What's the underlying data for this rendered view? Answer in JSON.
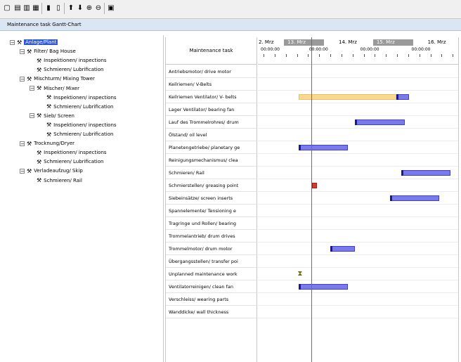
{
  "toolbar": {
    "buttons": [
      {
        "name": "new-document-icon",
        "glyph": "▢"
      },
      {
        "name": "print-icon",
        "glyph": "▤"
      },
      {
        "name": "print-preview-icon",
        "glyph": "▥"
      },
      {
        "name": "export-icon",
        "glyph": "▦"
      },
      {
        "name": "columns-icon",
        "glyph": "▮"
      },
      {
        "name": "page-setup-icon",
        "glyph": "▯"
      },
      {
        "name": "move-up-icon",
        "glyph": "⬆"
      },
      {
        "name": "move-down-icon",
        "glyph": "⬇"
      },
      {
        "name": "zoom-in-icon",
        "glyph": "⊕"
      },
      {
        "name": "zoom-out-icon",
        "glyph": "⊖"
      },
      {
        "name": "clipboard-icon",
        "glyph": "▣"
      }
    ]
  },
  "window": {
    "title": "Maintenance task Gantt-Chart"
  },
  "tree": {
    "nodes": [
      {
        "label": "Anlage/Plant",
        "depth": 0,
        "toggle": "−",
        "selected": true
      },
      {
        "label": "Filter/ Bag House",
        "depth": 1,
        "toggle": "−"
      },
      {
        "label": "Inspektionen/ inspections",
        "depth": 2,
        "toggle": ""
      },
      {
        "label": "Schmieren/ Lubrification",
        "depth": 2,
        "toggle": ""
      },
      {
        "label": "Mischturm/ Mixing Tower",
        "depth": 1,
        "toggle": "−"
      },
      {
        "label": "Mischer/ Mixer",
        "depth": 2,
        "toggle": "−"
      },
      {
        "label": "Inspektionen/ inspections",
        "depth": 3,
        "toggle": ""
      },
      {
        "label": "Schmieren/ Lubrification",
        "depth": 3,
        "toggle": ""
      },
      {
        "label": "Sieb/ Screen",
        "depth": 2,
        "toggle": "−"
      },
      {
        "label": "Inspektionen/ inspections",
        "depth": 3,
        "toggle": ""
      },
      {
        "label": "Schmieren/ Lubrification",
        "depth": 3,
        "toggle": ""
      },
      {
        "label": "Trocknung/Dryer",
        "depth": 1,
        "toggle": "−"
      },
      {
        "label": "Inspektionen/ inspections",
        "depth": 2,
        "toggle": ""
      },
      {
        "label": "Schmieren/ Lubrification",
        "depth": 2,
        "toggle": ""
      },
      {
        "label": "Verladeaufzug/ Skip",
        "depth": 1,
        "toggle": "−"
      },
      {
        "label": "Schmieren/ Rail",
        "depth": 2,
        "toggle": ""
      }
    ]
  },
  "tasks": {
    "header": "Maintenance task",
    "rows": [
      "Antriebsmotor/ drive motor",
      "Keilriemen/ V-Belts",
      "Keilriemen Ventilator/ V- belts",
      "Lager Ventilator/ bearing fan",
      "Lauf des Trommelrohres/ drum",
      "Ölstand/ oil level",
      "Planetengetriebe/ planetary ge",
      "Reinigungsmechanismus/ clea",
      "Schmieren/ Rail",
      "Schmierstellen/ greasing point",
      "Siebeinsätze/ screen inserts",
      "Spannelemente/ Tensioning e",
      "Tragringe und Rollen/ bearing",
      "Trommelantrieb/ drum drives",
      "Trommelmotor/ drum motor",
      "Übergangsstellen/ transfer poi",
      "Unplanned maintenance work",
      "Ventilatorreinigen/ clean fan",
      "Verschleiss/ wearing parts",
      "Wanddicke/ wall thickness"
    ]
  },
  "gantt": {
    "dates": [
      {
        "label": "2. Mrz",
        "shaded": false
      },
      {
        "label": "13. Mrz",
        "shaded": true
      },
      {
        "label": "14. Mrz",
        "shaded": false
      },
      {
        "label": "15. Mrz",
        "shaded": true
      },
      {
        "label": "16. Mrz",
        "shaded": false
      }
    ],
    "times": [
      "00:00:00",
      "00:00:00",
      "00:00:00",
      "00:00:00"
    ],
    "bars": [
      {
        "row": 2,
        "start": 0.205,
        "end": 0.69,
        "style": "yellow"
      },
      {
        "row": 2,
        "start": 0.69,
        "end": 0.755,
        "style": "blue",
        "cap": "start"
      },
      {
        "row": 4,
        "start": 0.485,
        "end": 0.735,
        "style": "blue",
        "cap": "start"
      },
      {
        "row": 6,
        "start": 0.205,
        "end": 0.45,
        "style": "blue",
        "cap": "start"
      },
      {
        "row": 8,
        "start": 0.715,
        "end": 0.96,
        "style": "blue",
        "cap": "start"
      },
      {
        "row": 9,
        "start": 0.27,
        "end": 0.295,
        "style": "red"
      },
      {
        "row": 10,
        "start": 0.66,
        "end": 0.905,
        "style": "blue",
        "cap": "start"
      },
      {
        "row": 14,
        "start": 0.36,
        "end": 0.485,
        "style": "blue",
        "cap": "start"
      },
      {
        "row": 17,
        "start": 0.205,
        "end": 0.45,
        "style": "blue",
        "cap": "start"
      }
    ],
    "milestones": [
      {
        "row": 16,
        "pos": 0.205,
        "glyph": "⧗"
      }
    ],
    "today": 0.265
  }
}
